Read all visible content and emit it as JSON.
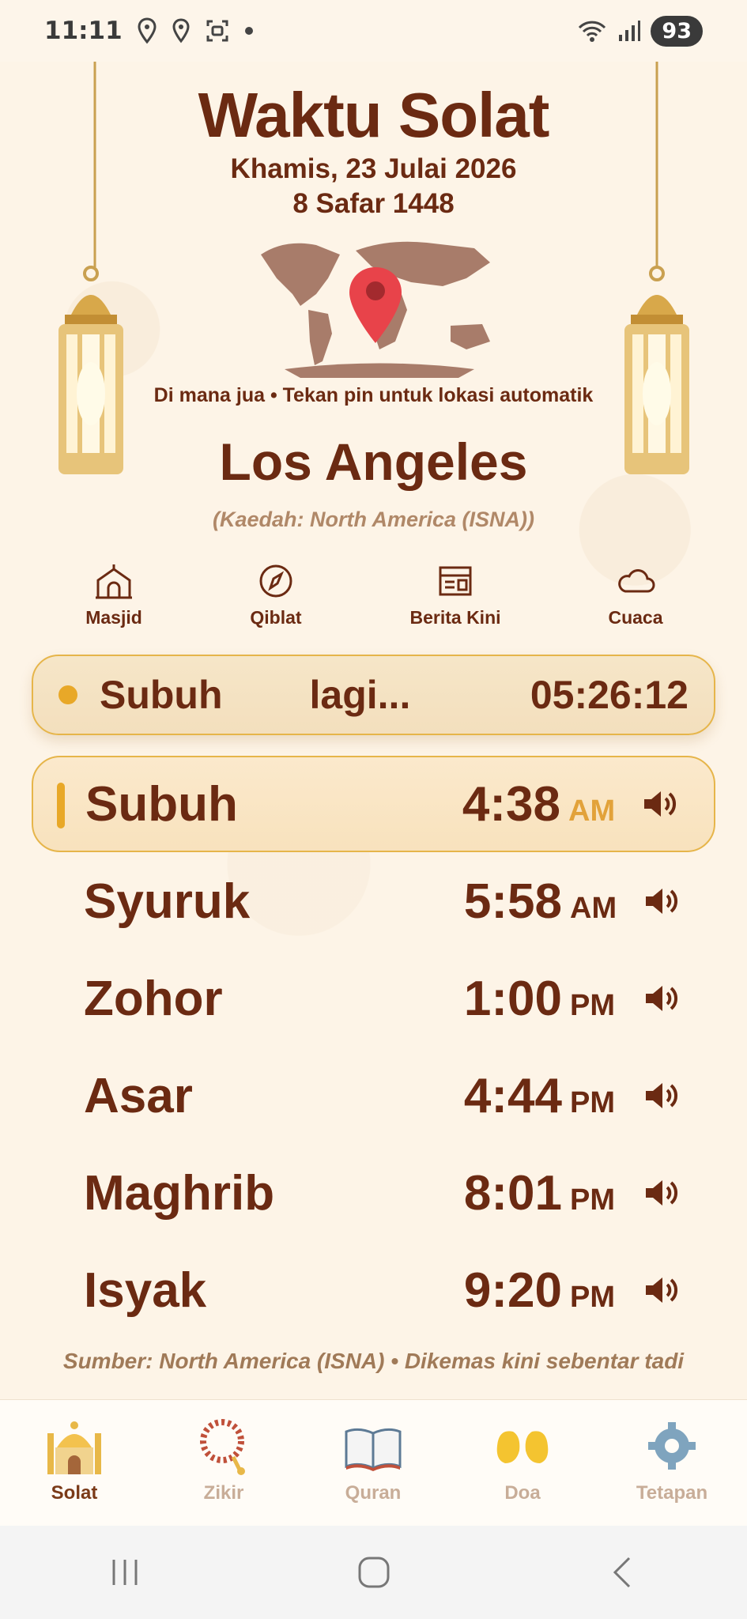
{
  "status_bar": {
    "time": "11:11",
    "battery": "93"
  },
  "header": {
    "title": "Waktu Solat",
    "gregorian_date": "Khamis, 23 Julai 2026",
    "hijri_date": "8 Safar 1448",
    "location_hint": "Di mana jua • Tekan pin untuk lokasi automatik",
    "city": "Los Angeles",
    "method": "(Kaedah: North America (ISNA))"
  },
  "quick_actions": [
    {
      "label": "Masjid",
      "icon": "mosque-icon"
    },
    {
      "label": "Qiblat",
      "icon": "compass-icon"
    },
    {
      "label": "Berita Kini",
      "icon": "newspaper-icon"
    },
    {
      "label": "Cuaca",
      "icon": "cloud-icon"
    }
  ],
  "countdown": {
    "prayer": "Subuh",
    "label": "lagi...",
    "remaining": "05:26:12"
  },
  "prayers": [
    {
      "name": "Subuh",
      "time": "4:38",
      "ampm": "AM",
      "active": true
    },
    {
      "name": "Syuruk",
      "time": "5:58",
      "ampm": "AM",
      "active": false
    },
    {
      "name": "Zohor",
      "time": "1:00",
      "ampm": "PM",
      "active": false
    },
    {
      "name": "Asar",
      "time": "4:44",
      "ampm": "PM",
      "active": false
    },
    {
      "name": "Maghrib",
      "time": "8:01",
      "ampm": "PM",
      "active": false
    },
    {
      "name": "Isyak",
      "time": "9:20",
      "ampm": "PM",
      "active": false
    }
  ],
  "source": "Sumber: North America (ISNA) • Dikemas kini sebentar tadi",
  "bottom_nav": [
    {
      "label": "Solat",
      "icon": "mosque-icon",
      "active": true
    },
    {
      "label": "Zikir",
      "icon": "prayer-beads-icon",
      "active": false
    },
    {
      "label": "Quran",
      "icon": "open-book-icon",
      "active": false
    },
    {
      "label": "Doa",
      "icon": "praying-hands-icon",
      "active": false
    },
    {
      "label": "Tetapan",
      "icon": "gear-icon",
      "active": false
    }
  ],
  "colors": {
    "primary_text": "#6b2a12",
    "accent_gold": "#e6b54a",
    "background": "#fdf4e7",
    "pin_red": "#e8434a"
  }
}
